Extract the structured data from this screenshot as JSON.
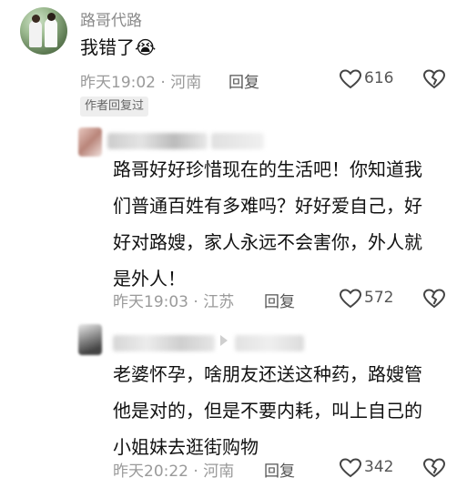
{
  "comments": [
    {
      "username": "路哥代路",
      "text": "我错了😭",
      "time": "昨天19:02",
      "location": "河南",
      "reply_label": "回复",
      "likes": "616",
      "author_tag": "作者回复过"
    },
    {
      "username": "",
      "text_lines": [
        "路哥好好珍惜现在的生活吧！你知道我",
        "们普通百姓有多难吗？好好爱自己，好",
        "好对路嫂，家人永远不会害你，外人就",
        "是外人！"
      ],
      "time": "昨天19:03",
      "location": "江苏",
      "reply_label": "回复",
      "likes": "572"
    },
    {
      "username": "",
      "text_lines": [
        "老婆怀孕，啥朋友还送这种药，路嫂管",
        "他是对的，但是不要内耗，叫上自己的",
        "小姐妹去逛街购物"
      ],
      "time": "昨天20:22",
      "location": "河南",
      "reply_label": "回复",
      "likes": "342"
    }
  ],
  "separator": "·",
  "icons": {
    "like": "heart-outline-icon",
    "dislike": "broken-heart-icon"
  }
}
